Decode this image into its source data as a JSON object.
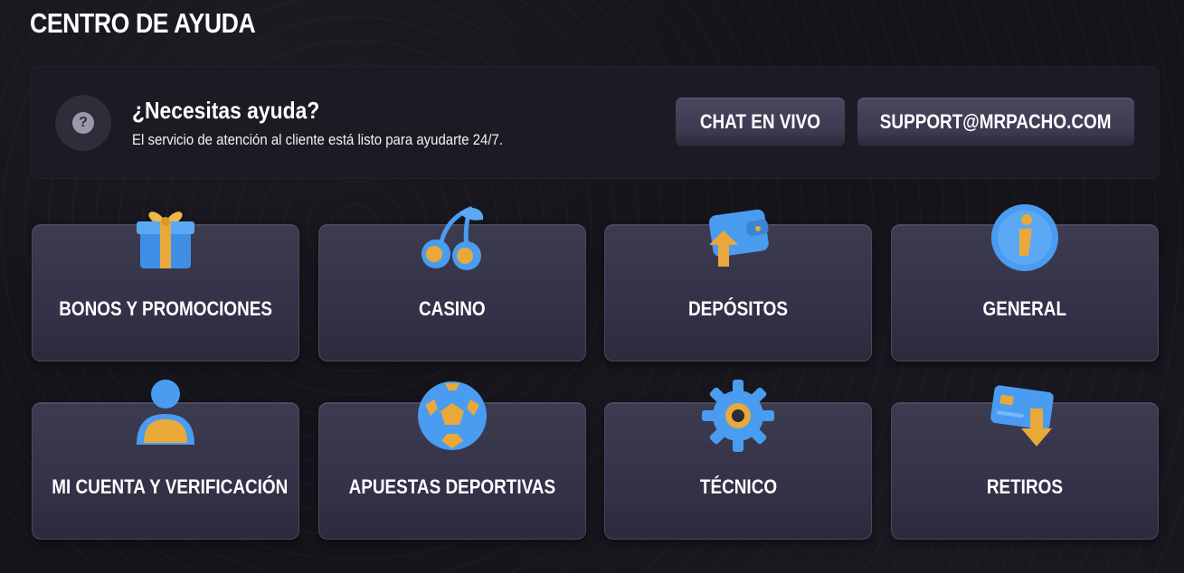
{
  "page": {
    "title": "CENTRO DE AYUDA"
  },
  "help_banner": {
    "icon": "question-icon",
    "icon_glyph": "?",
    "heading": "¿Necesitas ayuda?",
    "subtitle": "El servicio de atención al cliente está listo para ayudarte 24/7.",
    "chat_label": "CHAT EN VIVO",
    "email_label": "SUPPORT@MRPACHO.COM"
  },
  "categories": [
    {
      "label": "BONOS Y PROMOCIONES",
      "icon": "gift-icon"
    },
    {
      "label": "CASINO",
      "icon": "cherries-icon"
    },
    {
      "label": "DEPÓSITOS",
      "icon": "wallet-deposit-icon"
    },
    {
      "label": "GENERAL",
      "icon": "info-icon"
    },
    {
      "label": "MI CUENTA Y VERIFICACIÓN",
      "icon": "user-icon"
    },
    {
      "label": "APUESTAS DEPORTIVAS",
      "icon": "soccer-ball-icon"
    },
    {
      "label": "TÉCNICO",
      "icon": "gear-icon"
    },
    {
      "label": "RETIROS",
      "icon": "card-withdraw-icon"
    }
  ],
  "colors": {
    "background": "#15141b",
    "banner": "#1c1b24",
    "card": "#3a384d",
    "icon_blue": "#4a9cf0",
    "icon_gold": "#e8a93a"
  }
}
